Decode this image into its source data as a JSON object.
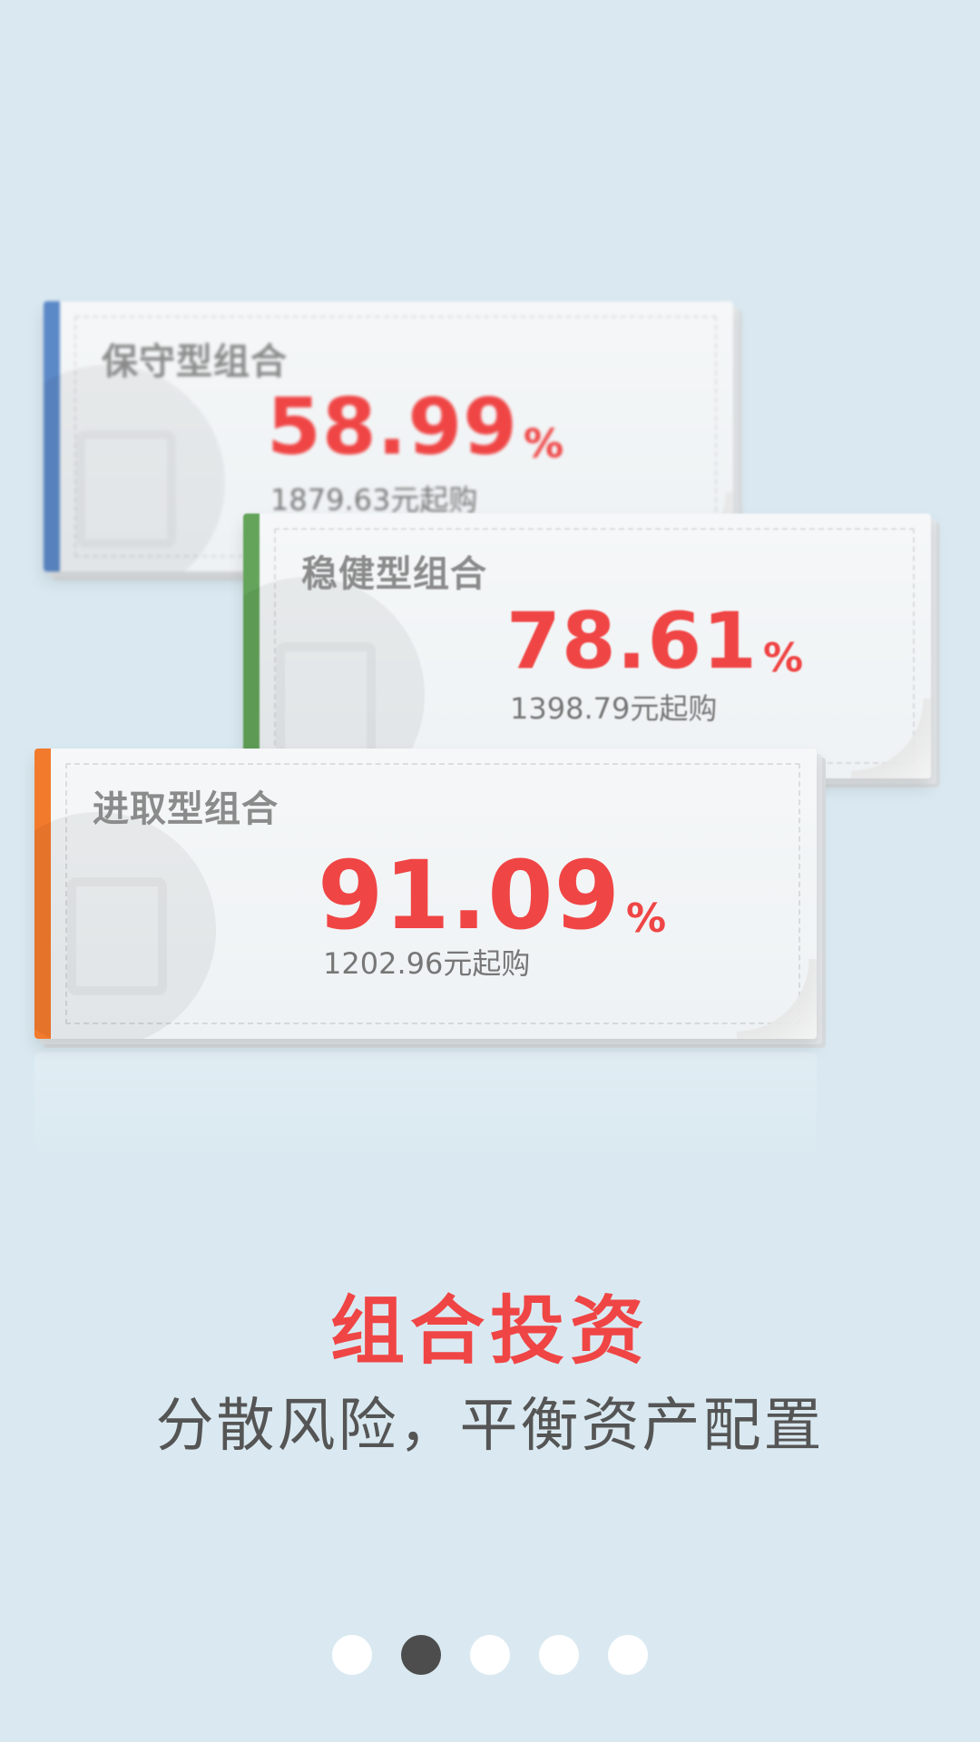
{
  "cards": [
    {
      "title": "保守型组合",
      "rate": "58.99",
      "percent": "%",
      "min_purchase": "1879.63元起购",
      "accent_color": "#5b88c7"
    },
    {
      "title": "稳健型组合",
      "rate": "78.61",
      "percent": "%",
      "min_purchase": "1398.79元起购",
      "accent_color": "#63a45a"
    },
    {
      "title": "进取型组合",
      "rate": "91.09",
      "percent": "%",
      "min_purchase": "1202.96元起购",
      "accent_color": "#f27a2c"
    }
  ],
  "headline": "组合投资",
  "subheadline": "分散风险，平衡资产配置",
  "pager": {
    "active_index": 1,
    "count": 5
  },
  "colors": {
    "background": "#dae9f1",
    "headline": "#f04545",
    "dot_active": "#4d4d4d",
    "dot_inactive": "#ffffff"
  }
}
